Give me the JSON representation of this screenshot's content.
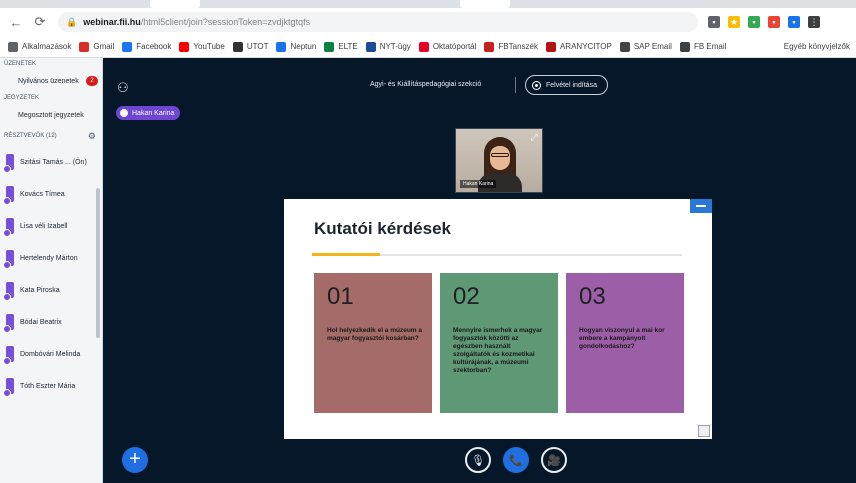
{
  "browser": {
    "url_domain": "webinar.fii.hu",
    "url_path": "/html5client/join?sessionToken=zvdjktgtqfs",
    "bookmarks": [
      {
        "label": "Alkalmazások",
        "color": "#5f6368"
      },
      {
        "label": "Gmail",
        "color": "#d93025"
      },
      {
        "label": "Facebook",
        "color": "#1877f2"
      },
      {
        "label": "YouTube",
        "color": "#ff0000"
      },
      {
        "label": "UTOT",
        "color": "#333333"
      },
      {
        "label": "Neptun",
        "color": "#1a73e8"
      },
      {
        "label": "ELTE",
        "color": "#0b8043"
      },
      {
        "label": "NYT-ügy",
        "color": "#1a4b9c"
      },
      {
        "label": "Oktatóportál",
        "color": "#e60023"
      },
      {
        "label": "FBTanszék",
        "color": "#c5221f"
      },
      {
        "label": "ARANYCITOP",
        "color": "#b31412"
      },
      {
        "label": "SAP Email",
        "color": "#444444"
      },
      {
        "label": "FB Email",
        "color": "#3c4043"
      }
    ],
    "bookmarks_right": "Egyéb könyvjelzők"
  },
  "left_panel": {
    "section_messages": "Üzenetek",
    "chat_item": "Nyilvános üzenetek",
    "chat_badge": "2",
    "section_notes": "Jegyzetek",
    "notes_item": "Megosztott jegyzetek",
    "section_users": "Résztvevők (12)",
    "users": [
      {
        "name": "Szitási Tamás ... (Ön)",
        "color": "#7a4fd8"
      },
      {
        "name": "Kovács Tímea",
        "color": "#7a4fd8"
      },
      {
        "name": "Lisa véli Izabell",
        "color": "#7a4fd8"
      },
      {
        "name": "Hertelendy Márton",
        "color": "#7a4fd8"
      },
      {
        "name": "Kata Piroska",
        "color": "#7a4fd8"
      },
      {
        "name": "Bódai Beatrix",
        "color": "#7a4fd8"
      },
      {
        "name": "Dombóvári Melinda",
        "color": "#7a4fd8"
      },
      {
        "name": "Tóth Eszter Mária",
        "color": "#7a4fd8"
      }
    ]
  },
  "meeting": {
    "title": "Agyi- és Kiállításpedagógiai szekció",
    "record_label": "Felvétel indítása",
    "presenter_name": "Hakan Karina",
    "webcam_name": "Hakan Karina"
  },
  "slide": {
    "title": "Kutatói kérdések",
    "cards": [
      {
        "num": "01",
        "text": "Hol helyezkedik el a múzeum a magyar fogyasztói kosárban?",
        "color": "#a56b69"
      },
      {
        "num": "02",
        "text": "Mennyire ismerhek a magyar fogyasztók közötti az egészben használt szolgáltatók és kozmetikai kultúrájának, a múzeumi szektorban?",
        "color": "#5f9874"
      },
      {
        "num": "03",
        "text": "Hogyan viszonyul a mai kor embere a kampányolt gondolkodáshoz?",
        "color": "#9d5ea8"
      }
    ]
  },
  "controls": {
    "plus_glyph": "+",
    "mute_glyph": "🎙",
    "phone_glyph": "📞",
    "camera_glyph": "🎥"
  }
}
